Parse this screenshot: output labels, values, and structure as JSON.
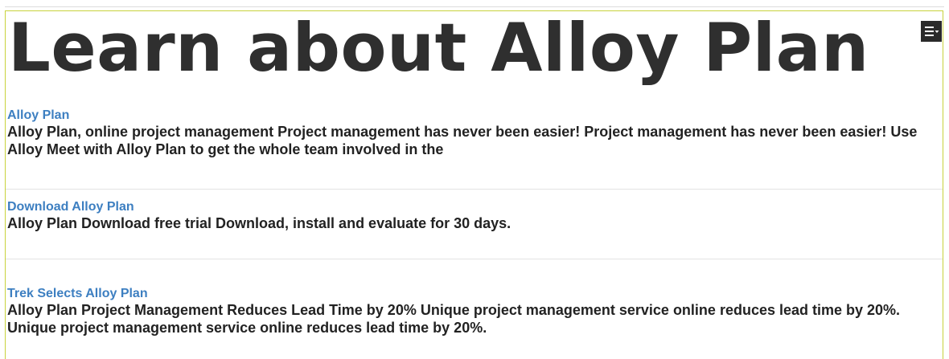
{
  "page": {
    "title": "Learn about Alloy Plan",
    "menu_icon": "list-menu-dropdown-icon"
  },
  "colors": {
    "frame_border": "#c8d23c",
    "link": "#3d7fc1",
    "title": "#2f2f2f",
    "snippet": "#222222",
    "menu_button_bg": "#2a2a2a"
  },
  "results": [
    {
      "link": "Alloy Plan",
      "snippet": "Alloy Plan, online project management Project management has never been easier! Project management has never been easier! Use Alloy Meet with Alloy Plan to get the whole team involved in the"
    },
    {
      "link": "Download Alloy Plan",
      "snippet": "Alloy Plan Download free trial Download, install and evaluate for 30 days."
    },
    {
      "link": "Trek Selects Alloy Plan",
      "snippet": "Alloy Plan Project Management Reduces Lead Time by 20% Unique project management service online reduces lead time by 20%. Unique project management service online reduces lead time by 20%."
    }
  ]
}
